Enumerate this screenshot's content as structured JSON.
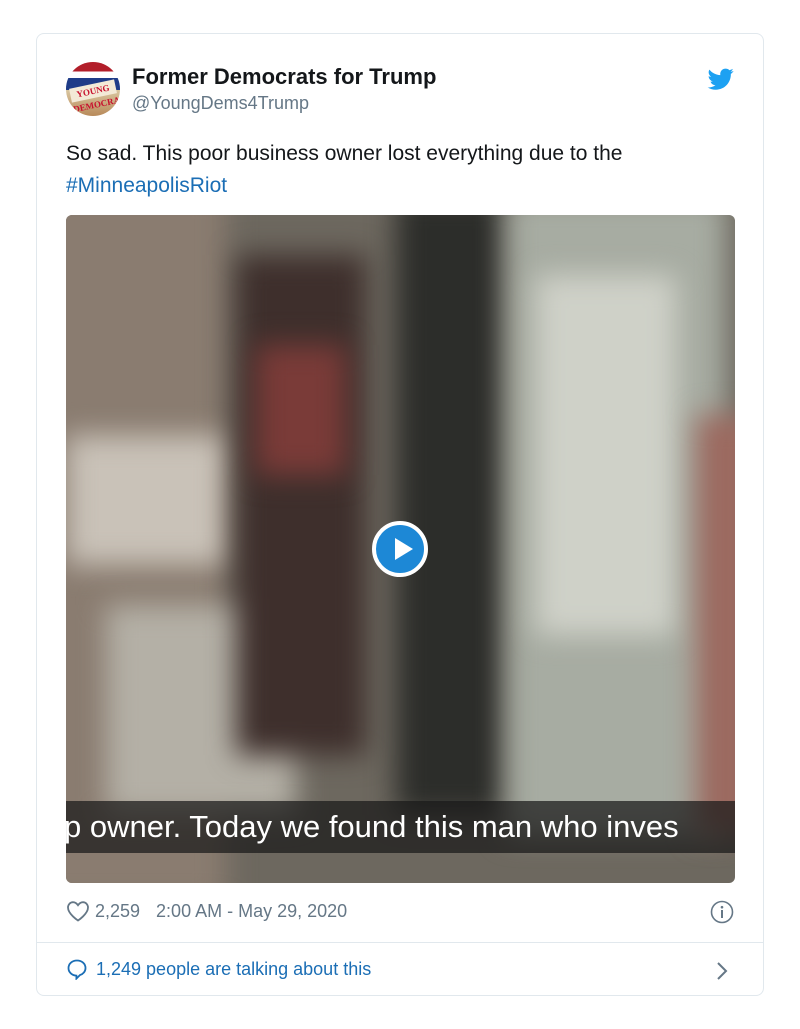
{
  "author": {
    "name": "Former Democrats for Trump",
    "handle": "@YoungDems4Trump",
    "avatar_text": "YOUNG DEMOCRATS"
  },
  "tweet": {
    "text": "So sad. This poor business owner lost everything due to the",
    "hashtag": "#MinneapolisRiot"
  },
  "video": {
    "caption": "p owner. Today we found this man who inves",
    "play_icon": "play-icon"
  },
  "meta": {
    "likes": "2,259",
    "timestamp": "2:00 AM - May 29, 2020"
  },
  "conversation": {
    "label": "1,249 people are talking about this"
  },
  "icons": {
    "brand": "twitter-bird-icon",
    "like": "heart-icon",
    "info": "info-icon",
    "reply": "speech-bubble-icon",
    "more": "chevron-right-icon"
  },
  "colors": {
    "twitter_blue": "#1da1f2",
    "link_blue": "#1b6eb5",
    "secondary_text": "#657786",
    "border": "#e1e8ed"
  }
}
